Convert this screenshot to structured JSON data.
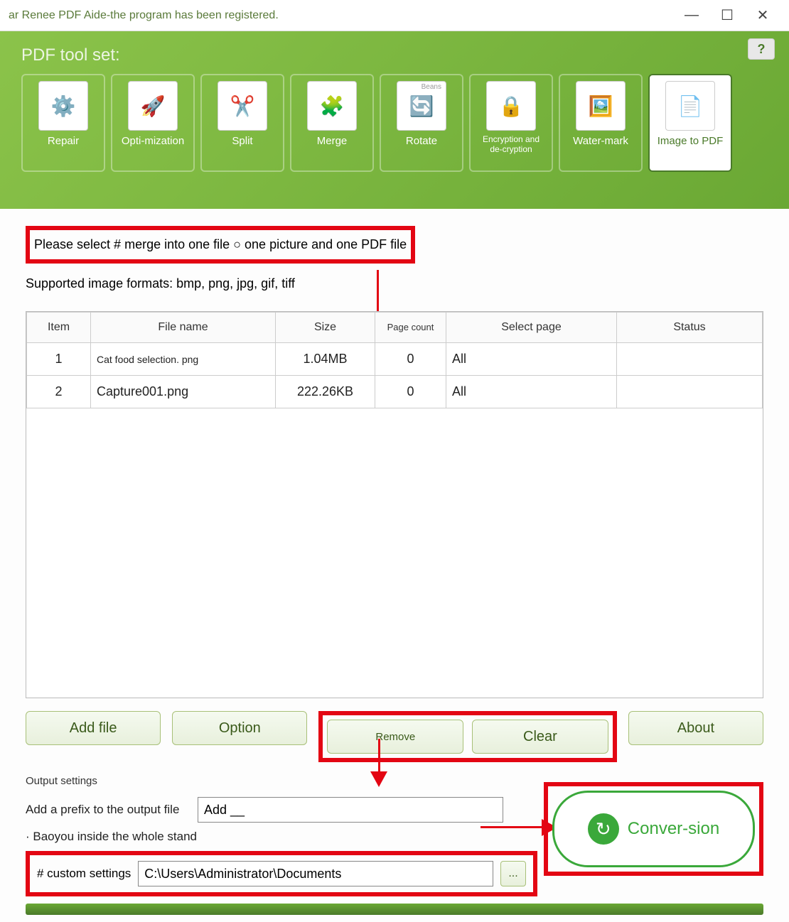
{
  "titlebar": {
    "text": "ar Renee PDF Aide-the program has been registered."
  },
  "toolbar": {
    "title": "PDF tool set:",
    "tools": [
      {
        "label": "Repair",
        "icon": "⚙️"
      },
      {
        "label": "Opti-mization",
        "icon": "🚀"
      },
      {
        "label": "Split",
        "icon": "✂️"
      },
      {
        "label": "Merge",
        "icon": "🧩"
      },
      {
        "label": "Rotate",
        "icon": "🔄",
        "badge": "Beans"
      },
      {
        "label": "Encryption and de-cryption",
        "icon": "🔒"
      },
      {
        "label": "Water-mark",
        "icon": "🖼️"
      },
      {
        "label": "Image to PDF",
        "icon": "📄"
      }
    ]
  },
  "selection": {
    "text": "Please select   # merge into one file ○ one picture and one PDF file"
  },
  "formats": "Supported image formats: bmp, png, jpg, gif, tiff",
  "table": {
    "headers": {
      "item": "Item",
      "filename": "File name",
      "size": "Size",
      "pagecount": "Page count",
      "selectpage": "Select page",
      "status": "Status"
    },
    "rows": [
      {
        "item": "1",
        "filename": "Cat food selection. png",
        "size": "1.04MB",
        "pagecount": "0",
        "selectpage": "All",
        "status": ""
      },
      {
        "item": "2",
        "filename": "Capture001.png",
        "size": "222.26KB",
        "pagecount": "0",
        "selectpage": "All",
        "status": ""
      }
    ]
  },
  "buttons": {
    "addfile": "Add file",
    "option": "Option",
    "remove": "Remove",
    "clear": "Clear",
    "about": "About"
  },
  "output": {
    "title": "Output settings",
    "prefix_label": "Add a prefix to the output file",
    "prefix_value": "Add __",
    "baoyou": "· Baoyou inside the whole stand",
    "custom_label": "#  custom settings",
    "custom_value": "C:\\Users\\Administrator\\Documents",
    "browse": "...",
    "convert": "Conver-sion"
  }
}
